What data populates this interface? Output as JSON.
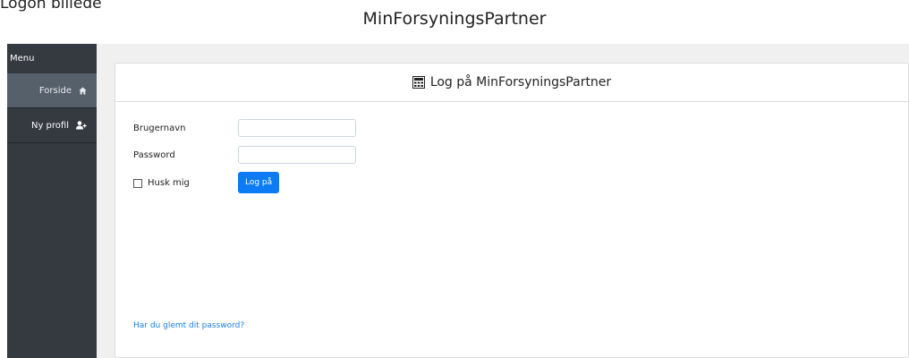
{
  "page": {
    "caption": "Logon billede",
    "app_title": "MinForsyningsPartner"
  },
  "sidebar": {
    "heading": "Menu",
    "items": [
      {
        "label": "Forside",
        "icon": "home-icon",
        "active": true
      },
      {
        "label": "Ny profil",
        "icon": "add-user-icon",
        "active": false
      }
    ]
  },
  "login_card": {
    "title": "Log på MinForsyningsPartner",
    "title_icon": "calculator-icon",
    "username_label": "Brugernavn",
    "username_value": "",
    "password_label": "Password",
    "password_value": "",
    "remember_label": "Husk mig",
    "remember_checked": false,
    "submit_label": "Log på",
    "forgot_link": "Har du glemt dit password?"
  },
  "colors": {
    "sidebar_bg": "#343a40",
    "sidebar_active": "#56606a",
    "primary": "#0d7bf5",
    "link": "#1a7fe0",
    "content_bg": "#f0f0f0"
  }
}
